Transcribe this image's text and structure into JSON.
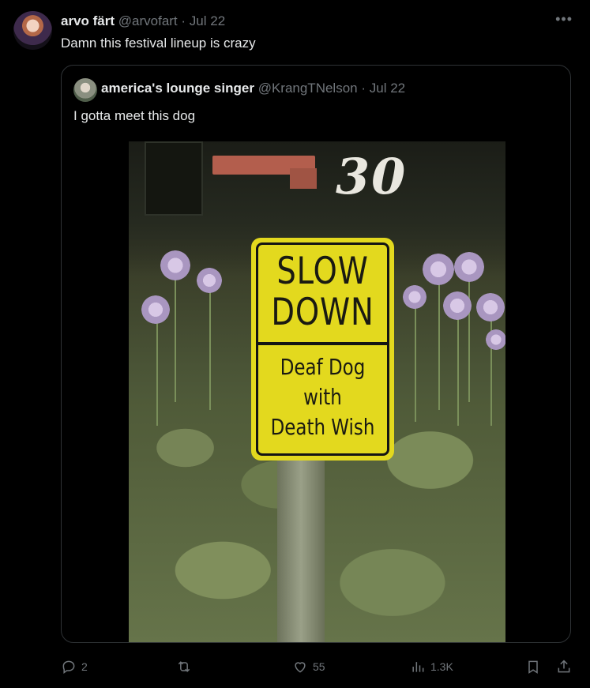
{
  "tweet": {
    "author_name": "arvo färt",
    "author_handle": "@arvofart",
    "separator": "·",
    "date": "Jul 22",
    "text": "Damn this festival lineup is crazy",
    "more_icon": "more-horizontal-icon"
  },
  "quoted_tweet": {
    "author_name": "america's lounge singer",
    "author_handle": "@KrangTNelson",
    "separator": "·",
    "date": "Jul 22",
    "text": "I gotta meet this dog",
    "photo": {
      "house_number": "30",
      "sign_lines_top": [
        "SLOW",
        "DOWN"
      ],
      "sign_lines_bottom": [
        "Deaf Dog",
        "with",
        "Death Wish"
      ]
    }
  },
  "actions": {
    "reply": {
      "icon": "reply-icon",
      "count": "2"
    },
    "repost": {
      "icon": "repost-icon",
      "count": ""
    },
    "like": {
      "icon": "heart-icon",
      "count": "55"
    },
    "views": {
      "icon": "views-chart-icon",
      "count": "1.3K"
    },
    "bookmark": {
      "icon": "bookmark-icon"
    },
    "share": {
      "icon": "share-icon"
    }
  },
  "colors": {
    "background": "#000000",
    "text": "#e7e9ea",
    "muted": "#71767b",
    "border": "#2f3336",
    "sign_yellow": "#e3d91e"
  }
}
